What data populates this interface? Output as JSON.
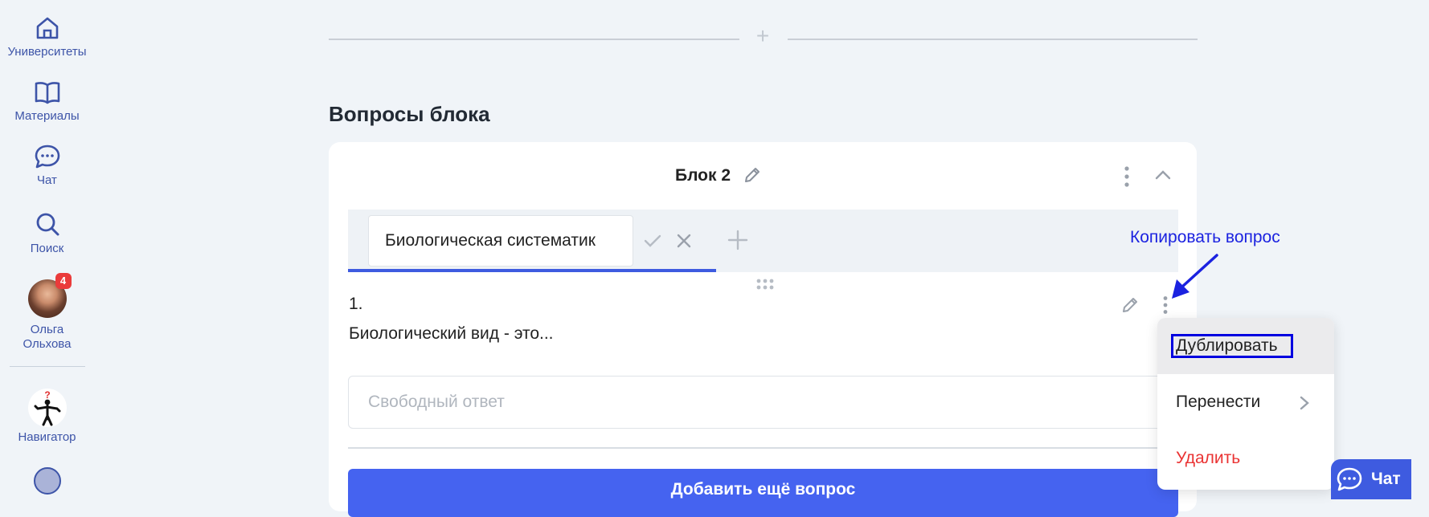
{
  "sidebar": {
    "items": [
      {
        "label": "Университеты",
        "icon": "home-icon"
      },
      {
        "label": "Материалы",
        "icon": "book-icon"
      },
      {
        "label": "Чат",
        "icon": "chat-icon"
      },
      {
        "label": "Поиск",
        "icon": "search-icon"
      }
    ],
    "profile": {
      "name_line1": "Ольга",
      "name_line2": "Ольхова",
      "badge_count": "4"
    },
    "navigator": {
      "label": "Навигатор",
      "glyph": "?"
    }
  },
  "section": {
    "title": "Вопросы блока"
  },
  "block": {
    "title": "Блок 2",
    "tab_input_value": "Биологическая систематик",
    "question": {
      "number": "1.",
      "text": "Биологический вид - это..."
    },
    "answer_placeholder": "Свободный ответ",
    "add_question_label": "Добавить ещё вопрос"
  },
  "annotation": {
    "text": "Копировать вопрос"
  },
  "context_menu": {
    "items": [
      {
        "label": "Дублировать"
      },
      {
        "label": "Перенести"
      },
      {
        "label": "Удалить"
      }
    ]
  },
  "chat_button": {
    "label": "Чат"
  },
  "colors": {
    "accent": "#3e5be0",
    "sidebar_text": "#3d54a8",
    "danger": "#ea3333",
    "annotation": "#1b22e0",
    "page_bg": "#f0f4f8"
  }
}
